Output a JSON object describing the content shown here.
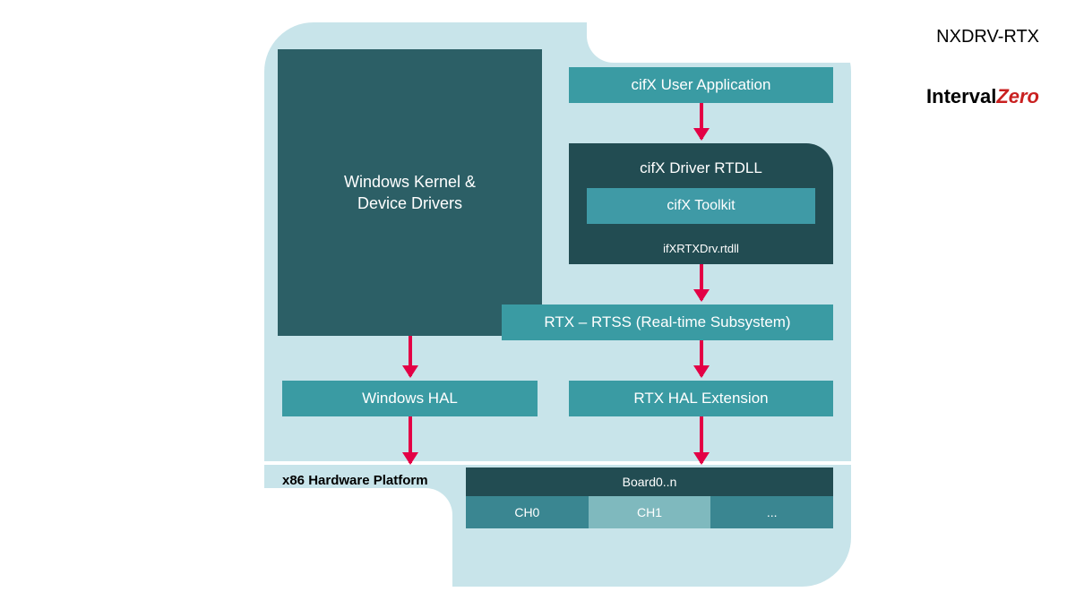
{
  "header": {
    "title": "NXDRV-RTX",
    "brand_prefix": "Interval",
    "brand_suffix": "Zero"
  },
  "kernel": {
    "line1": "Windows Kernel &",
    "line2": "Device Drivers"
  },
  "user_app": "cifX User Application",
  "rtdll": {
    "title": "cifX Driver RTDLL",
    "toolkit": "cifX Toolkit",
    "file": "ifXRTXDrv.rtdll"
  },
  "rtss": "RTX – RTSS (Real-time Subsystem)",
  "winhal": "Windows HAL",
  "rtxhal": "RTX HAL Extension",
  "platform_label": "x86 Hardware Platform",
  "board": {
    "title": "Board0..n",
    "ch0": "CH0",
    "ch1": "CH1",
    "chn": "..."
  }
}
